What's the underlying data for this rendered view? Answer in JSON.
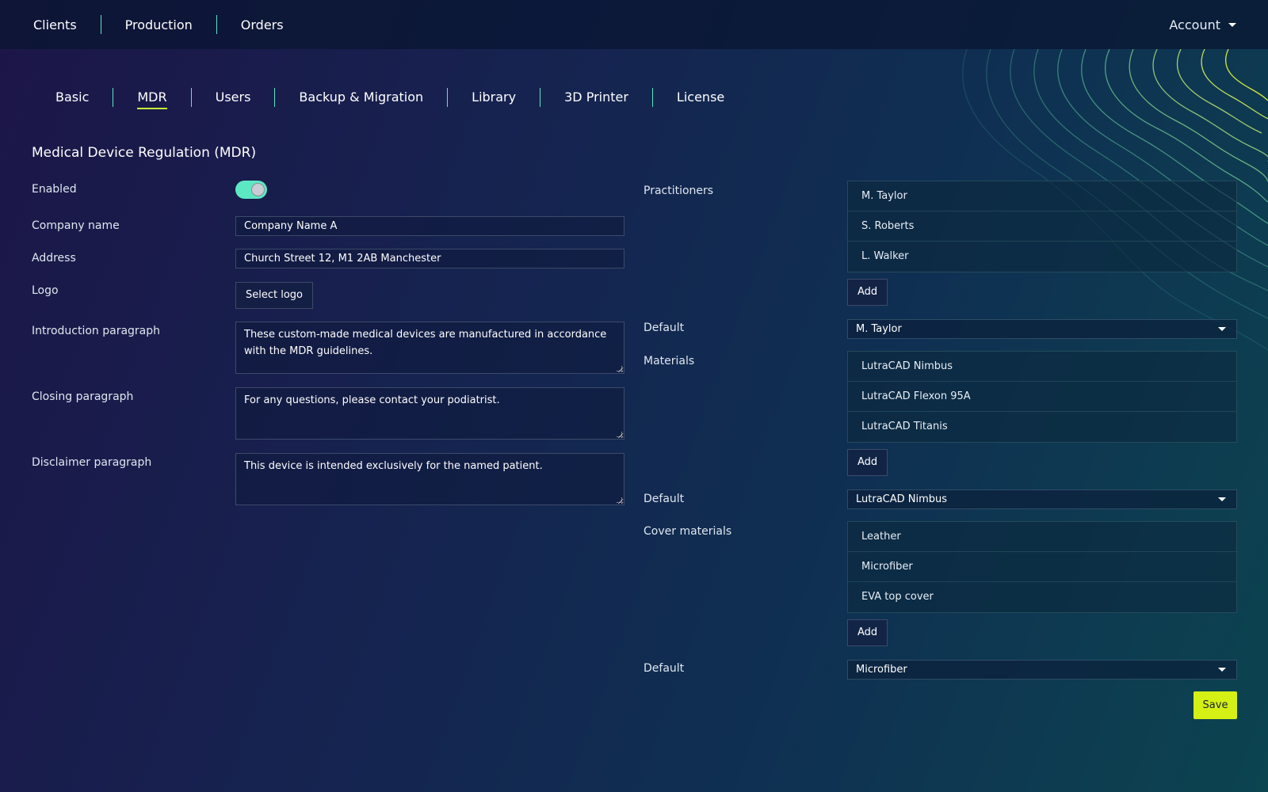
{
  "topnav": {
    "links": [
      "Clients",
      "Production",
      "Orders"
    ],
    "account_label": "Account"
  },
  "tabs": {
    "items": [
      "Basic",
      "MDR",
      "Users",
      "Backup & Migration",
      "Library",
      "3D Printer",
      "License"
    ],
    "active": "MDR"
  },
  "mdr": {
    "title": "Medical Device Regulation (MDR)",
    "enabled_label": "Enabled",
    "enabled": true,
    "company_name_label": "Company name",
    "company_name": "Company Name A",
    "address_label": "Address",
    "address": "Church Street 12, M1 2AB Manchester",
    "logo_label": "Logo",
    "select_logo_label": "Select logo",
    "intro_label": "Introduction paragraph",
    "intro_text": "These custom-made medical devices are manufactured in accordance with the MDR guidelines.",
    "closing_label": "Closing paragraph",
    "closing_text": "For any questions, please contact your podiatrist.",
    "disclaimer_label": "Disclaimer paragraph",
    "disclaimer_text": "This device is intended exclusively for the named patient."
  },
  "practitioners": {
    "label": "Practitioners",
    "items": [
      "M. Taylor",
      "S. Roberts",
      "L. Walker"
    ],
    "add_label": "Add",
    "default_label": "Default",
    "default_value": "M. Taylor"
  },
  "materials": {
    "label": "Materials",
    "items": [
      "LutraCAD Nimbus",
      "LutraCAD Flexon 95A",
      "LutraCAD Titanis"
    ],
    "add_label": "Add",
    "default_label": "Default",
    "default_value": "LutraCAD Nimbus"
  },
  "cover_materials": {
    "label": "Cover materials",
    "items": [
      "Leather",
      "Microfiber",
      "EVA top cover"
    ],
    "add_label": "Add",
    "default_label": "Default",
    "default_value": "Microfiber"
  },
  "save_label": "Save",
  "colors": {
    "accent_lime": "#d4f015",
    "accent_teal": "#5de8c4"
  }
}
